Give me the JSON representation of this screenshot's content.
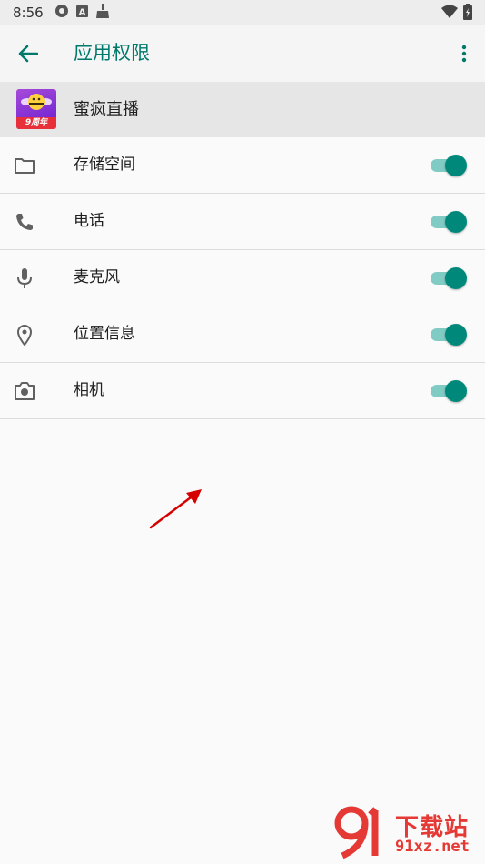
{
  "status_bar": {
    "time": "8:56",
    "left_icons": [
      "aperture-icon",
      "font-a-icon",
      "broom-icon"
    ],
    "right_icons": [
      "wifi-icon",
      "battery-icon"
    ]
  },
  "toolbar": {
    "title": "应用权限",
    "back_icon": "arrow-left-icon",
    "overflow_icon": "more-vert-icon",
    "accent": "#00796b"
  },
  "app": {
    "name": "蜜疯直播",
    "icon_badge": "9周年"
  },
  "permissions": [
    {
      "label": "存储空间",
      "icon": "folder-icon",
      "enabled": true
    },
    {
      "label": "电话",
      "icon": "phone-icon",
      "enabled": true
    },
    {
      "label": "麦克风",
      "icon": "microphone-icon",
      "enabled": true
    },
    {
      "label": "位置信息",
      "icon": "location-pin-icon",
      "enabled": true
    },
    {
      "label": "相机",
      "icon": "camera-icon",
      "enabled": true
    }
  ],
  "watermark": {
    "brand": "下载站",
    "url": "91xz.net"
  },
  "colors": {
    "toggle_on_thumb": "#00897b",
    "toggle_on_track": "#80cbc4",
    "annotation_arrow": "#d50000"
  }
}
